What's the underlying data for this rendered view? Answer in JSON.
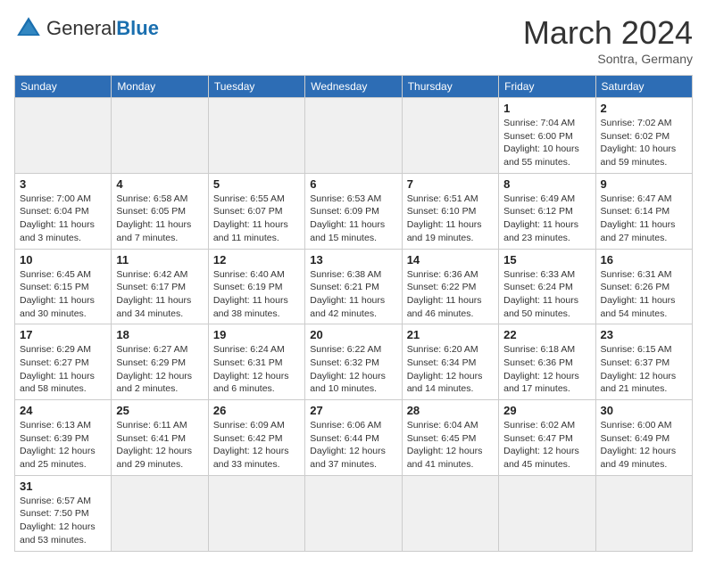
{
  "header": {
    "logo_general": "General",
    "logo_blue": "Blue",
    "month_title": "March 2024",
    "subtitle": "Sontra, Germany"
  },
  "weekdays": [
    "Sunday",
    "Monday",
    "Tuesday",
    "Wednesday",
    "Thursday",
    "Friday",
    "Saturday"
  ],
  "rows": [
    [
      {
        "day": "",
        "info": "",
        "empty": true
      },
      {
        "day": "",
        "info": "",
        "empty": true
      },
      {
        "day": "",
        "info": "",
        "empty": true
      },
      {
        "day": "",
        "info": "",
        "empty": true
      },
      {
        "day": "",
        "info": "",
        "empty": true
      },
      {
        "day": "1",
        "info": "Sunrise: 7:04 AM\nSunset: 6:00 PM\nDaylight: 10 hours and 55 minutes."
      },
      {
        "day": "2",
        "info": "Sunrise: 7:02 AM\nSunset: 6:02 PM\nDaylight: 10 hours and 59 minutes."
      }
    ],
    [
      {
        "day": "3",
        "info": "Sunrise: 7:00 AM\nSunset: 6:04 PM\nDaylight: 11 hours and 3 minutes."
      },
      {
        "day": "4",
        "info": "Sunrise: 6:58 AM\nSunset: 6:05 PM\nDaylight: 11 hours and 7 minutes."
      },
      {
        "day": "5",
        "info": "Sunrise: 6:55 AM\nSunset: 6:07 PM\nDaylight: 11 hours and 11 minutes."
      },
      {
        "day": "6",
        "info": "Sunrise: 6:53 AM\nSunset: 6:09 PM\nDaylight: 11 hours and 15 minutes."
      },
      {
        "day": "7",
        "info": "Sunrise: 6:51 AM\nSunset: 6:10 PM\nDaylight: 11 hours and 19 minutes."
      },
      {
        "day": "8",
        "info": "Sunrise: 6:49 AM\nSunset: 6:12 PM\nDaylight: 11 hours and 23 minutes."
      },
      {
        "day": "9",
        "info": "Sunrise: 6:47 AM\nSunset: 6:14 PM\nDaylight: 11 hours and 27 minutes."
      }
    ],
    [
      {
        "day": "10",
        "info": "Sunrise: 6:45 AM\nSunset: 6:15 PM\nDaylight: 11 hours and 30 minutes."
      },
      {
        "day": "11",
        "info": "Sunrise: 6:42 AM\nSunset: 6:17 PM\nDaylight: 11 hours and 34 minutes."
      },
      {
        "day": "12",
        "info": "Sunrise: 6:40 AM\nSunset: 6:19 PM\nDaylight: 11 hours and 38 minutes."
      },
      {
        "day": "13",
        "info": "Sunrise: 6:38 AM\nSunset: 6:21 PM\nDaylight: 11 hours and 42 minutes."
      },
      {
        "day": "14",
        "info": "Sunrise: 6:36 AM\nSunset: 6:22 PM\nDaylight: 11 hours and 46 minutes."
      },
      {
        "day": "15",
        "info": "Sunrise: 6:33 AM\nSunset: 6:24 PM\nDaylight: 11 hours and 50 minutes."
      },
      {
        "day": "16",
        "info": "Sunrise: 6:31 AM\nSunset: 6:26 PM\nDaylight: 11 hours and 54 minutes."
      }
    ],
    [
      {
        "day": "17",
        "info": "Sunrise: 6:29 AM\nSunset: 6:27 PM\nDaylight: 11 hours and 58 minutes."
      },
      {
        "day": "18",
        "info": "Sunrise: 6:27 AM\nSunset: 6:29 PM\nDaylight: 12 hours and 2 minutes."
      },
      {
        "day": "19",
        "info": "Sunrise: 6:24 AM\nSunset: 6:31 PM\nDaylight: 12 hours and 6 minutes."
      },
      {
        "day": "20",
        "info": "Sunrise: 6:22 AM\nSunset: 6:32 PM\nDaylight: 12 hours and 10 minutes."
      },
      {
        "day": "21",
        "info": "Sunrise: 6:20 AM\nSunset: 6:34 PM\nDaylight: 12 hours and 14 minutes."
      },
      {
        "day": "22",
        "info": "Sunrise: 6:18 AM\nSunset: 6:36 PM\nDaylight: 12 hours and 17 minutes."
      },
      {
        "day": "23",
        "info": "Sunrise: 6:15 AM\nSunset: 6:37 PM\nDaylight: 12 hours and 21 minutes."
      }
    ],
    [
      {
        "day": "24",
        "info": "Sunrise: 6:13 AM\nSunset: 6:39 PM\nDaylight: 12 hours and 25 minutes."
      },
      {
        "day": "25",
        "info": "Sunrise: 6:11 AM\nSunset: 6:41 PM\nDaylight: 12 hours and 29 minutes."
      },
      {
        "day": "26",
        "info": "Sunrise: 6:09 AM\nSunset: 6:42 PM\nDaylight: 12 hours and 33 minutes."
      },
      {
        "day": "27",
        "info": "Sunrise: 6:06 AM\nSunset: 6:44 PM\nDaylight: 12 hours and 37 minutes."
      },
      {
        "day": "28",
        "info": "Sunrise: 6:04 AM\nSunset: 6:45 PM\nDaylight: 12 hours and 41 minutes."
      },
      {
        "day": "29",
        "info": "Sunrise: 6:02 AM\nSunset: 6:47 PM\nDaylight: 12 hours and 45 minutes."
      },
      {
        "day": "30",
        "info": "Sunrise: 6:00 AM\nSunset: 6:49 PM\nDaylight: 12 hours and 49 minutes."
      }
    ],
    [
      {
        "day": "31",
        "info": "Sunrise: 6:57 AM\nSunset: 7:50 PM\nDaylight: 12 hours and 53 minutes."
      },
      {
        "day": "",
        "info": "",
        "empty": true
      },
      {
        "day": "",
        "info": "",
        "empty": true
      },
      {
        "day": "",
        "info": "",
        "empty": true
      },
      {
        "day": "",
        "info": "",
        "empty": true
      },
      {
        "day": "",
        "info": "",
        "empty": true
      },
      {
        "day": "",
        "info": "",
        "empty": true
      }
    ]
  ]
}
